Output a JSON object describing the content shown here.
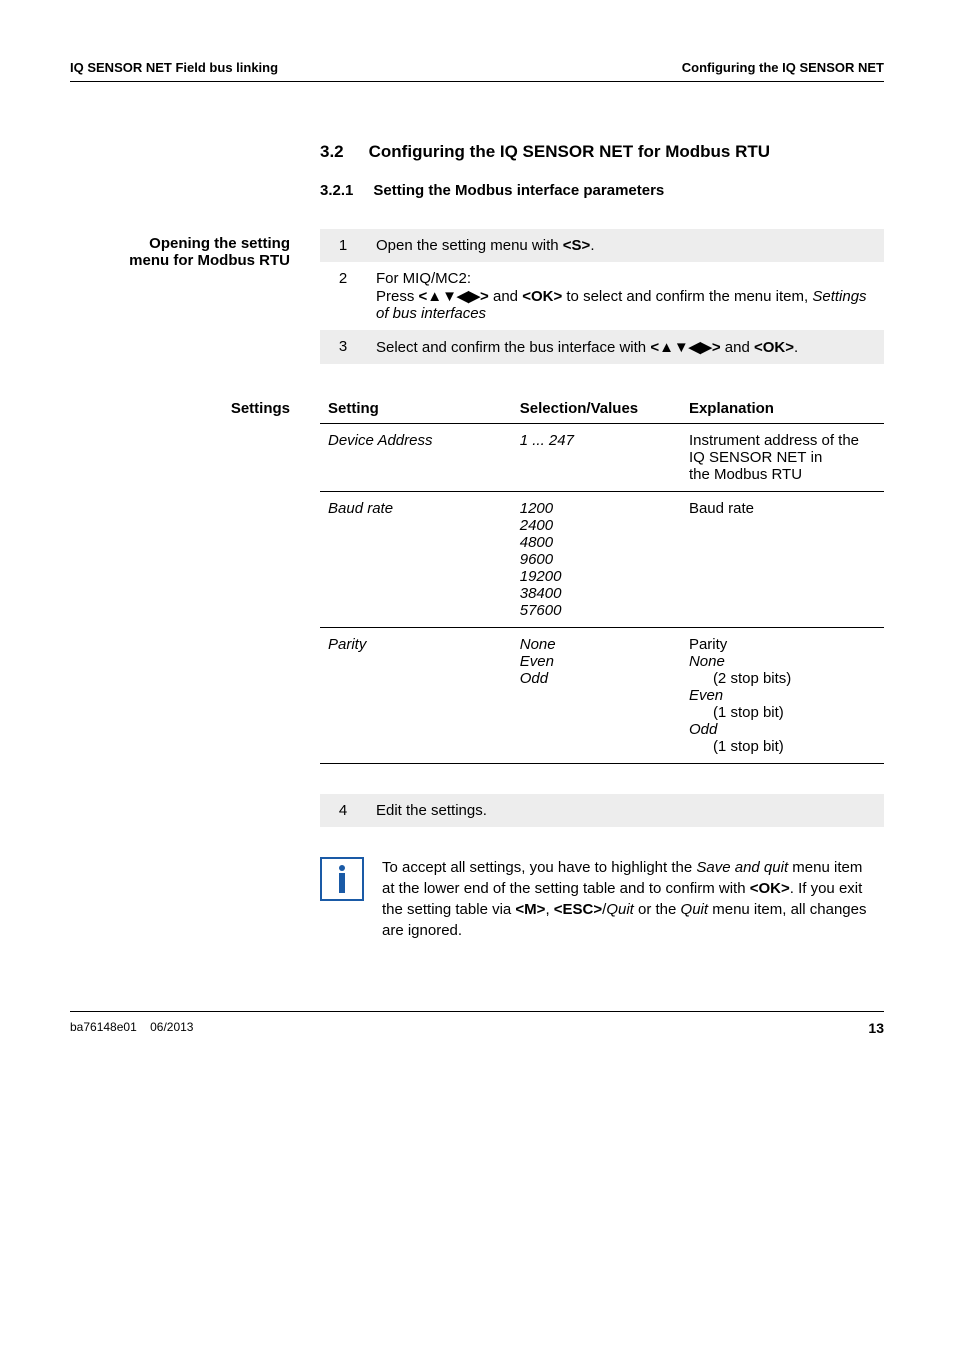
{
  "header": {
    "left_a": "IQ S",
    "left_b": "ENSOR",
    "left_c": " N",
    "left_d": "ET",
    "left_e": " Field bus linking",
    "right_a": "Configuring the IQ S",
    "right_b": "ENSOR",
    "right_c": " N",
    "right_d": "ET"
  },
  "section": {
    "num": "3.2",
    "title_a": "Configuring the IQ S",
    "title_b": "ENSOR",
    "title_c": " N",
    "title_d": "ET",
    "title_e": " for Modbus RTU"
  },
  "subsection": {
    "num": "3.2.1",
    "title": "Setting the Modbus interface parameters"
  },
  "opening_label_l1": "Opening the setting",
  "opening_label_l2": "menu for Modbus RTU",
  "steps": [
    {
      "n": "1",
      "text_a": "Open the setting menu with ",
      "bold_a": "<S>",
      "text_b": "."
    },
    {
      "n": "2",
      "line1": "For MIQ/MC2:",
      "line2_a": "Press ",
      "line2_bold1": "<▲▼◀▶>",
      "line2_mid": " and ",
      "line2_bold2": "<OK>",
      "line2_b": " to select and confirm the menu item, ",
      "line2_italic": "Settings of bus interfaces"
    },
    {
      "n": "3",
      "text_a": "Select and confirm the bus interface with ",
      "bold_a": "<▲▼◀▶>",
      "text_mid": " and ",
      "bold_b": "<OK>",
      "text_b": "."
    }
  ],
  "settings_label": "Settings",
  "settings_headers": {
    "c1": "Setting",
    "c2": "Selection/Values",
    "c3": "Explanation"
  },
  "settings_rows": {
    "r1": {
      "setting": "Device Address",
      "values": "1 ... 247",
      "expl_l1": "Instrument address of the",
      "expl_l2a": "IQ S",
      "expl_l2b": "ENSOR",
      "expl_l2c": " N",
      "expl_l2d": "ET",
      "expl_l2e": " in",
      "expl_l3": "the Modbus RTU"
    },
    "r2": {
      "setting": "Baud rate",
      "values": [
        "1200",
        "2400",
        "4800",
        "9600",
        "19200",
        "38400",
        "57600"
      ],
      "expl": "Baud rate"
    },
    "r3": {
      "setting": "Parity",
      "values": [
        "None",
        "Even",
        "Odd"
      ],
      "expl_title": "Parity",
      "expl_items": [
        {
          "k": "None",
          "v": "(2 stop bits)"
        },
        {
          "k": "Even",
          "v": "(1 stop bit)"
        },
        {
          "k": "Odd",
          "v": "(1 stop bit)"
        }
      ]
    }
  },
  "step4": {
    "n": "4",
    "text": "Edit the settings."
  },
  "info": {
    "a": "To accept all settings, you have to highlight the ",
    "i1": "Save and quit",
    "b": " menu item at the lower end of the setting table and to confirm with ",
    "bold1": "<OK>",
    "c": ". If you exit the setting table via ",
    "bold2": "<M>",
    "d": ", ",
    "bold3": "<ESC>",
    "e": "/",
    "i2": "Quit",
    "f": " or the ",
    "i3": "Quit",
    "g": " menu item, all changes are ignored."
  },
  "footer": {
    "left_a": "ba76148e01",
    "left_b": "06/2013",
    "page": "13"
  }
}
